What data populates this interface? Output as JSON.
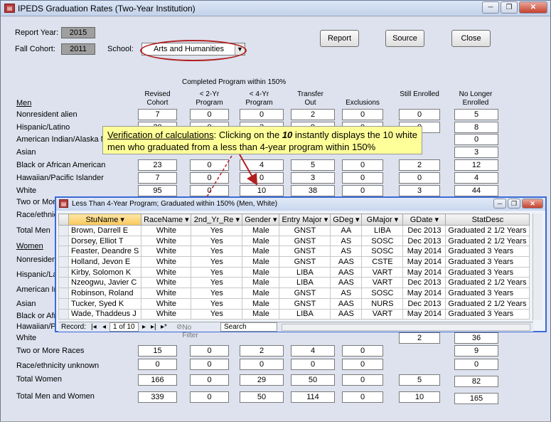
{
  "window": {
    "title": "IPEDS Graduation Rates (Two-Year Institution)"
  },
  "form": {
    "report_year_label": "Report Year:",
    "report_year": "2015",
    "fall_cohort_label": "Fall Cohort:",
    "fall_cohort": "2011",
    "school_label": "School:",
    "school_value": "Arts and Humanities",
    "buttons": {
      "report": "Report",
      "source": "Source",
      "close": "Close"
    },
    "completed_label": "Completed Program within 150%",
    "headers": [
      "Revised Cohort",
      "< 2-Yr Program",
      "< 4-Yr Program",
      "Transfer Out",
      "Exclusions",
      "Still Enrolled",
      "No Longer Enrolled"
    ],
    "men_label": "Men",
    "women_label": "Women",
    "men_rows": [
      {
        "label": "Nonresident alien",
        "values": [
          "7",
          "0",
          "0",
          "2",
          "0",
          "0",
          "5"
        ]
      },
      {
        "label": "Hispanic/Latino",
        "values": [
          "20",
          "0",
          "3",
          "9",
          "0",
          "0",
          "8"
        ]
      },
      {
        "label": "American Indian/Alaska Nati",
        "values": [
          "",
          "",
          "",
          "",
          "",
          "",
          "0"
        ]
      },
      {
        "label": "Asian",
        "values": [
          "",
          "",
          "",
          "",
          "",
          "",
          "3"
        ]
      },
      {
        "label": "Black or African American",
        "values": [
          "23",
          "0",
          "4",
          "5",
          "0",
          "2",
          "12"
        ]
      },
      {
        "label": "Hawaiian/Pacific Islander",
        "values": [
          "7",
          "0",
          "0",
          "3",
          "0",
          "0",
          "4"
        ]
      },
      {
        "label": "White",
        "values": [
          "95",
          "0",
          "10",
          "38",
          "0",
          "3",
          "44"
        ]
      },
      {
        "label": "Two or More",
        "values": []
      },
      {
        "label": "Race/ethnicit",
        "values": []
      },
      {
        "label": "Total Men",
        "values": []
      }
    ],
    "women_rows": [
      {
        "label": "Nonresident"
      },
      {
        "label": "Hispanic/Lati"
      },
      {
        "label": "American Ind"
      },
      {
        "label": "Asian"
      },
      {
        "label": "Black or Afric"
      },
      {
        "label": "Hawaiian/Pac"
      },
      {
        "label": "White",
        "values": [
          "",
          "",
          "",
          "",
          "",
          "2",
          "36"
        ]
      },
      {
        "label": "Two or More Races",
        "values": [
          "15",
          "0",
          "2",
          "4",
          "0",
          "",
          "9"
        ]
      },
      {
        "label": "Race/ethnicity unknown",
        "values": [
          "0",
          "0",
          "0",
          "0",
          "0",
          "",
          "0"
        ]
      },
      {
        "label": "Total Women",
        "values": [
          "166",
          "0",
          "29",
          "50",
          "0",
          "5",
          "82"
        ]
      }
    ],
    "total_all": {
      "label": "Total Men and Women",
      "values": [
        "339",
        "0",
        "50",
        "114",
        "0",
        "10",
        "165"
      ]
    }
  },
  "callout": {
    "prefix": "Verification of calculations",
    "text1": ":  Clicking on the ",
    "number": "10",
    "text2": " instantly displays the 10 white men who graduated from a less than 4-year program within 150%"
  },
  "popup": {
    "title": "Less Than 4-Year Program; Graduated within 150% (Men, White)",
    "columns": [
      "StuName",
      "RaceName",
      "2nd_Yr_Re",
      "Gender",
      "Entry Major",
      "GDeg",
      "GMajor",
      "GDate",
      "StatDesc"
    ],
    "rows": [
      [
        "Brown, Darrell E",
        "White",
        "Yes",
        "Male",
        "GNST",
        "AA",
        "LIBA",
        "Dec 2013",
        "Graduated 2 1/2 Years"
      ],
      [
        "Dorsey, Elliot T",
        "White",
        "Yes",
        "Male",
        "GNST",
        "AS",
        "SOSC",
        "Dec 2013",
        "Graduated 2 1/2 Years"
      ],
      [
        "Feaster, Deandre S",
        "White",
        "Yes",
        "Male",
        "GNST",
        "AS",
        "SOSC",
        "May 2014",
        "Graduated 3 Years"
      ],
      [
        "Holland, Jevon E",
        "White",
        "Yes",
        "Male",
        "GNST",
        "AAS",
        "CSTE",
        "May 2014",
        "Graduated 3 Years"
      ],
      [
        "Kirby, Solomon K",
        "White",
        "Yes",
        "Male",
        "LIBA",
        "AAS",
        "VART",
        "May 2014",
        "Graduated 3 Years"
      ],
      [
        "Nzeogwu, Javier C",
        "White",
        "Yes",
        "Male",
        "LIBA",
        "AAS",
        "VART",
        "Dec 2013",
        "Graduated 2 1/2 Years"
      ],
      [
        "Robinson, Roland",
        "White",
        "Yes",
        "Male",
        "GNST",
        "AS",
        "SOSC",
        "May 2014",
        "Graduated 3 Years"
      ],
      [
        "Tucker, Syed K",
        "White",
        "Yes",
        "Male",
        "GNST",
        "AAS",
        "NURS",
        "Dec 2013",
        "Graduated 2 1/2 Years"
      ],
      [
        "Wade, Thaddeus J",
        "White",
        "Yes",
        "Male",
        "LIBA",
        "AAS",
        "VART",
        "May 2014",
        "Graduated 3 Years"
      ]
    ],
    "nav": {
      "record_label": "Record:",
      "position": "1 of 10",
      "filter": "No Filter",
      "search": "Search"
    }
  },
  "colors": {
    "ellipse": "#b21f1f",
    "callout_bg": "#ffff99",
    "arrow": "#b21f1f",
    "popup_border": "#3a6ad8"
  }
}
